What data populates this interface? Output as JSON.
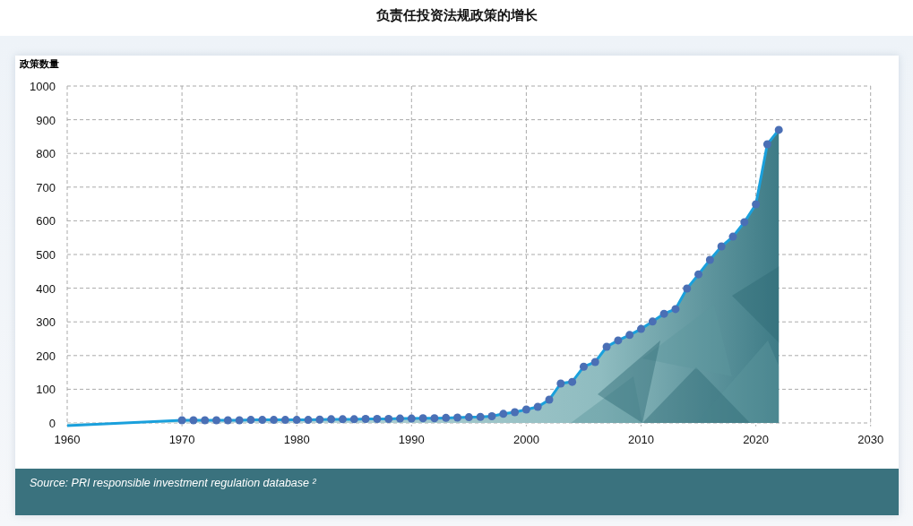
{
  "title": "负责任投资法规政策的增长",
  "chart": {
    "chart_data": {
      "type": "area",
      "ylabel": "政策数量",
      "x": [
        1960,
        1970,
        1971,
        1972,
        1973,
        1974,
        1975,
        1976,
        1977,
        1978,
        1979,
        1980,
        1981,
        1982,
        1983,
        1984,
        1985,
        1986,
        1987,
        1988,
        1989,
        1990,
        1991,
        1992,
        1993,
        1994,
        1995,
        1996,
        1997,
        1998,
        1999,
        2000,
        2001,
        2002,
        2003,
        2004,
        2005,
        2006,
        2007,
        2008,
        2009,
        2010,
        2011,
        2012,
        2013,
        2014,
        2015,
        2016,
        2017,
        2018,
        2019,
        2020,
        2021,
        2022
      ],
      "series": [
        {
          "color": "#4a6fb5",
          "values": [
            -8,
            8,
            8,
            8,
            8,
            8,
            8,
            9,
            9,
            9,
            9,
            9,
            9,
            10,
            11,
            11,
            11,
            12,
            12,
            12,
            13,
            13,
            14,
            14,
            15,
            16,
            17,
            18,
            20,
            27,
            32,
            40,
            48,
            69,
            117,
            122,
            167,
            181,
            226,
            245,
            261,
            279,
            301,
            324,
            338,
            399,
            441,
            484,
            524,
            553,
            596,
            649,
            827,
            870
          ]
        }
      ],
      "xlim": [
        1960,
        2030
      ],
      "ylim": [
        -10,
        1000
      ],
      "grid": true,
      "xticks": [
        1960,
        1970,
        1980,
        1990,
        2000,
        2010,
        2020,
        2030
      ],
      "yticks": [
        0,
        100,
        200,
        300,
        400,
        500,
        600,
        700,
        800,
        900,
        1000
      ]
    }
  },
  "source": "Source: PRI responsible investment regulation database ²"
}
